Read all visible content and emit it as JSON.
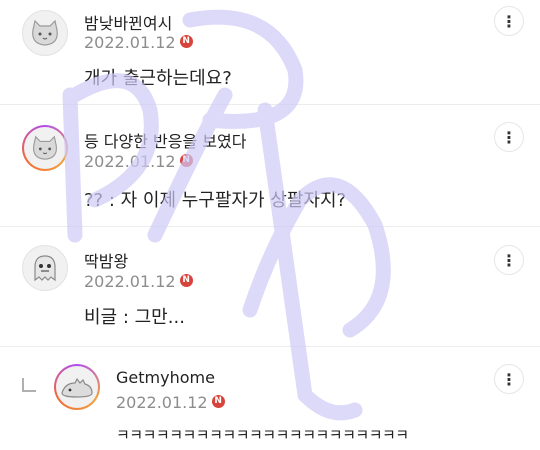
{
  "comments": [
    {
      "author": "밤낮바뀐여시",
      "date": "2022.01.12",
      "new_badge": "N",
      "text": "개가 출근하는데요?"
    },
    {
      "author": "등 다양한 반응을 보였다",
      "date": "2022.01.12",
      "new_badge": "N",
      "text": "?? : 자 이제 누구팔자가 상팔자지?"
    },
    {
      "author": "딱밤왕",
      "date": "2022.01.12",
      "new_badge": "N",
      "text": "비글 : 그만..."
    },
    {
      "author": "Getmyhome",
      "date": "2022.01.12",
      "new_badge": "N",
      "text": "ㅋㅋㅋㅋㅋㅋㅋㅋㅋㅋㅋㅋㅋㅋㅋㅋㅋㅋㅋㅋㅋㅋ"
    }
  ],
  "more_glyph": "⋮",
  "colors": {
    "badge": "#d8443c",
    "date": "#8d8d8d",
    "overlay_stroke": "#cfc9f7"
  }
}
